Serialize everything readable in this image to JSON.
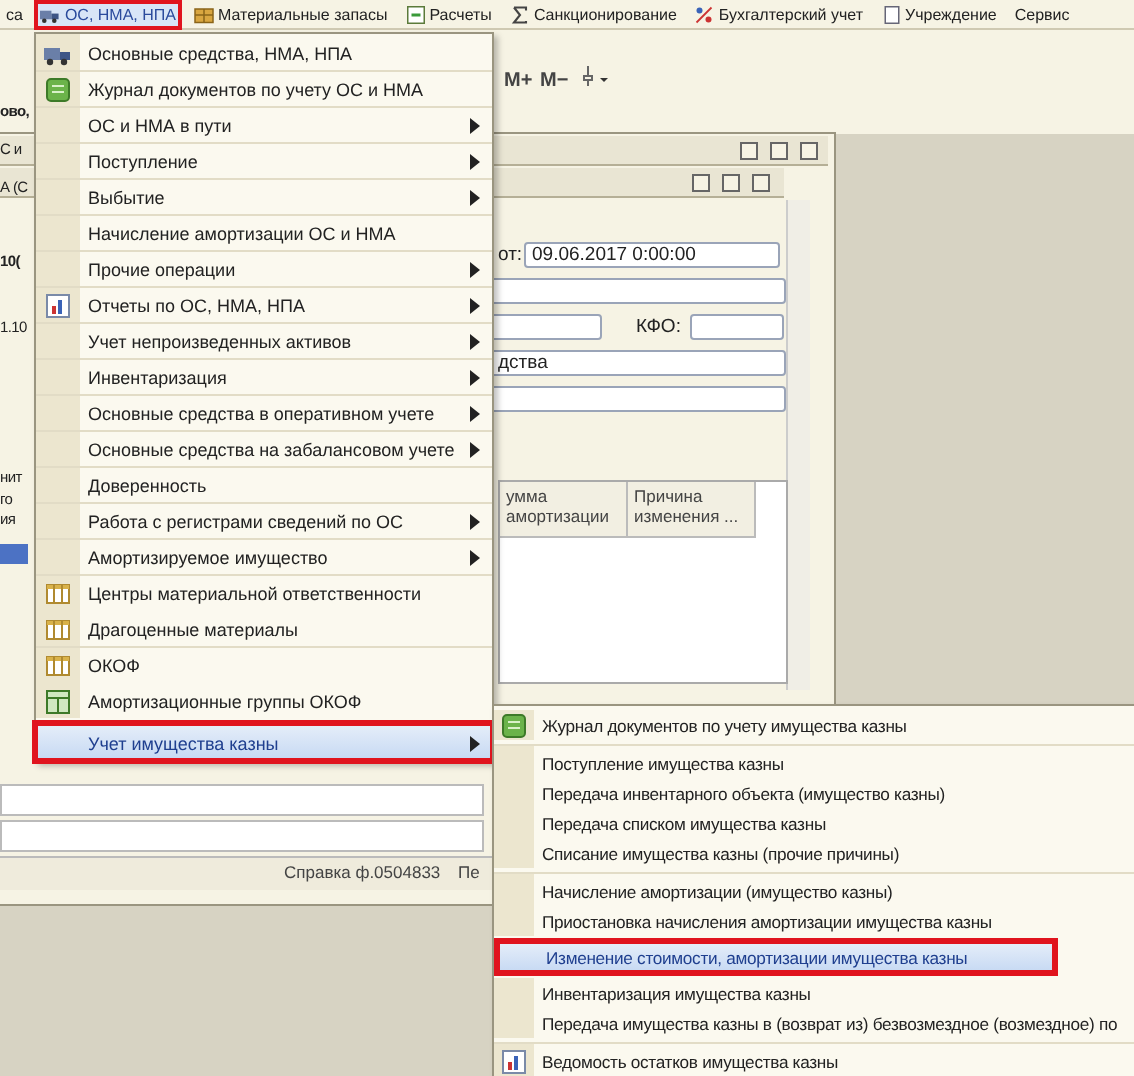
{
  "menu_bar": {
    "items": [
      {
        "label": "са",
        "kind": "none",
        "selected": false,
        "annotated": false
      },
      {
        "label": "ОС, НМА, НПА",
        "kind": "truck",
        "selected": true,
        "annotated": true
      },
      {
        "label": "Материальные запасы",
        "kind": "boxes",
        "selected": false,
        "annotated": false
      },
      {
        "label": "Расчеты",
        "kind": "calc",
        "selected": false,
        "annotated": false
      },
      {
        "label": "Санкционирование",
        "kind": "sum",
        "selected": false,
        "annotated": false
      },
      {
        "label": "Бухгалтерский учет",
        "kind": "accounting",
        "selected": false,
        "annotated": false
      },
      {
        "label": "Учреждение",
        "kind": "page",
        "selected": false,
        "annotated": false
      },
      {
        "label": "Сервис",
        "kind": "none",
        "selected": false,
        "annotated": false
      }
    ]
  },
  "toolbar": {
    "buttons": [
      "M+",
      "M−"
    ]
  },
  "document_window": {
    "fragments": [
      "ово,",
      "С и",
      "А (С",
      "10(",
      "1.10",
      "нит",
      "го",
      "ия"
    ],
    "date_label": "от:",
    "date_value": "09.06.2017 0:00:00",
    "kfo_label": "КФО:",
    "field_value": "дства",
    "columns": [
      "умма амортизации",
      "Причина изменения ..."
    ],
    "status_items": [
      "Справка ф.0504833",
      "Пе"
    ]
  },
  "main_menu": {
    "items": [
      {
        "label": "Основные средства, НМА, НПА",
        "kind": "truck",
        "submenu": false,
        "separator_before": false,
        "selected": false,
        "annotated": false
      },
      {
        "label": "Журнал документов по учету ОС и НМА",
        "kind": "journal",
        "submenu": false,
        "separator_before": true,
        "selected": false,
        "annotated": false
      },
      {
        "label": "ОС и НМА в пути",
        "kind": "none",
        "submenu": true,
        "separator_before": true,
        "selected": false,
        "annotated": false
      },
      {
        "label": "Поступление",
        "kind": "none",
        "submenu": true,
        "separator_before": true,
        "selected": false,
        "annotated": false
      },
      {
        "label": "Выбытие",
        "kind": "none",
        "submenu": true,
        "separator_before": true,
        "selected": false,
        "annotated": false
      },
      {
        "label": "Начисление амортизации ОС и НМА",
        "kind": "none",
        "submenu": false,
        "separator_before": true,
        "selected": false,
        "annotated": false
      },
      {
        "label": "Прочие операции",
        "kind": "none",
        "submenu": true,
        "separator_before": true,
        "selected": false,
        "annotated": false
      },
      {
        "label": "Отчеты по ОС, НМА, НПА",
        "kind": "report",
        "submenu": true,
        "separator_before": true,
        "selected": false,
        "annotated": false
      },
      {
        "label": "Учет непроизведенных активов",
        "kind": "none",
        "submenu": true,
        "separator_before": true,
        "selected": false,
        "annotated": false
      },
      {
        "label": "Инвентаризация",
        "kind": "none",
        "submenu": true,
        "separator_before": true,
        "selected": false,
        "annotated": false
      },
      {
        "label": "Основные средства в оперативном учете",
        "kind": "none",
        "submenu": true,
        "separator_before": true,
        "selected": false,
        "annotated": false
      },
      {
        "label": "Основные средства на забалансовом учете",
        "kind": "none",
        "submenu": true,
        "separator_before": true,
        "selected": false,
        "annotated": false
      },
      {
        "label": "Доверенность",
        "kind": "none",
        "submenu": false,
        "separator_before": true,
        "selected": false,
        "annotated": false
      },
      {
        "label": "Работа с регистрами сведений по ОС",
        "kind": "none",
        "submenu": true,
        "separator_before": true,
        "selected": false,
        "annotated": false
      },
      {
        "label": "Амортизируемое имущество",
        "kind": "none",
        "submenu": true,
        "separator_before": true,
        "selected": false,
        "annotated": false
      },
      {
        "label": "Центры материальной ответственности",
        "kind": "table",
        "submenu": false,
        "separator_before": true,
        "selected": false,
        "annotated": false
      },
      {
        "label": "Драгоценные материалы",
        "kind": "table",
        "submenu": false,
        "separator_before": false,
        "selected": false,
        "annotated": false
      },
      {
        "label": "ОКОФ",
        "kind": "table",
        "submenu": false,
        "separator_before": true,
        "selected": false,
        "annotated": false
      },
      {
        "label": "Амортизационные группы ОКОФ",
        "kind": "table-green",
        "submenu": false,
        "separator_before": false,
        "selected": false,
        "annotated": false
      },
      {
        "label": "Учет имущества казны",
        "kind": "none",
        "submenu": true,
        "separator_before": false,
        "selected": true,
        "annotated": true
      }
    ]
  },
  "submenu": {
    "items": [
      {
        "label": "Журнал документов по учету имущества казны",
        "kind": "journal",
        "separator_before": false,
        "selected": false,
        "annotated": false
      },
      {
        "label": "Поступление имущества казны",
        "kind": "none",
        "separator_before": true,
        "selected": false,
        "annotated": false
      },
      {
        "label": "Передача инвентарного объекта (имущество казны)",
        "kind": "none",
        "separator_before": false,
        "selected": false,
        "annotated": false
      },
      {
        "label": "Передача списком имущества казны",
        "kind": "none",
        "separator_before": false,
        "selected": false,
        "annotated": false
      },
      {
        "label": "Списание имущества казны (прочие причины)",
        "kind": "none",
        "separator_before": false,
        "selected": false,
        "annotated": false
      },
      {
        "label": "Начисление амортизации (имущество казны)",
        "kind": "none",
        "separator_before": true,
        "selected": false,
        "annotated": false
      },
      {
        "label": "Приостановка начисления амортизации имущества казны",
        "kind": "none",
        "separator_before": false,
        "selected": false,
        "annotated": false
      },
      {
        "label": "Изменение стоимости, амортизации имущества казны",
        "kind": "none",
        "separator_before": false,
        "selected": true,
        "annotated": true
      },
      {
        "label": "Инвентаризация имущества казны",
        "kind": "none",
        "separator_before": false,
        "selected": false,
        "annotated": false
      },
      {
        "label": "Передача имущества казны в (возврат из) безвозмездное (возмездное) по",
        "kind": "none",
        "separator_before": false,
        "selected": false,
        "annotated": false
      },
      {
        "label": "Ведомость остатков имущества казны",
        "kind": "report",
        "separator_before": true,
        "selected": false,
        "annotated": false
      }
    ]
  }
}
